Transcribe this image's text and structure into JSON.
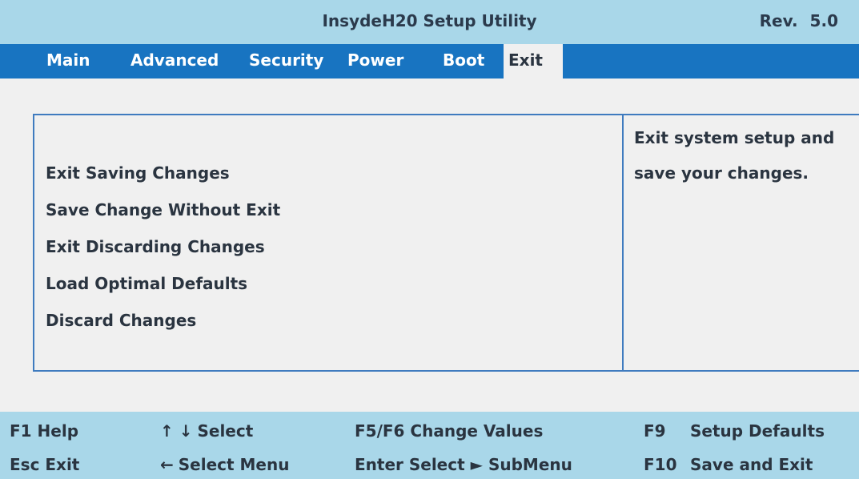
{
  "header": {
    "title": "InsydeH20 Setup Utility",
    "revision": "Rev. 5.0"
  },
  "tabs": [
    {
      "label": "Main"
    },
    {
      "label": "Advanced"
    },
    {
      "label": "Security"
    },
    {
      "label": "Power"
    },
    {
      "label": "Boot"
    },
    {
      "label": "Exit",
      "active": true
    }
  ],
  "menu": {
    "items": [
      "Exit Saving Changes",
      "Save Change Without Exit",
      "Exit Discarding Changes",
      "Load Optimal Defaults",
      "Discard Changes"
    ]
  },
  "help": {
    "line1": "Exit system setup and",
    "line2": "save your changes."
  },
  "footer": {
    "f1": "F1 Help",
    "esc": "Esc Exit",
    "updown": "Select",
    "left": "Select Menu",
    "f5f6": "F5/F6 Change Values",
    "enter": "Enter Select ► SubMenu",
    "f9_key": "F9",
    "f9_label": "Setup Defaults",
    "f10_key": "F10",
    "f10_label": "Save and Exit"
  },
  "colors": {
    "title_bar": "#a9d7e9",
    "menu_bar": "#1874c1",
    "background": "#f0f0f0",
    "border": "#3f7bbf"
  }
}
